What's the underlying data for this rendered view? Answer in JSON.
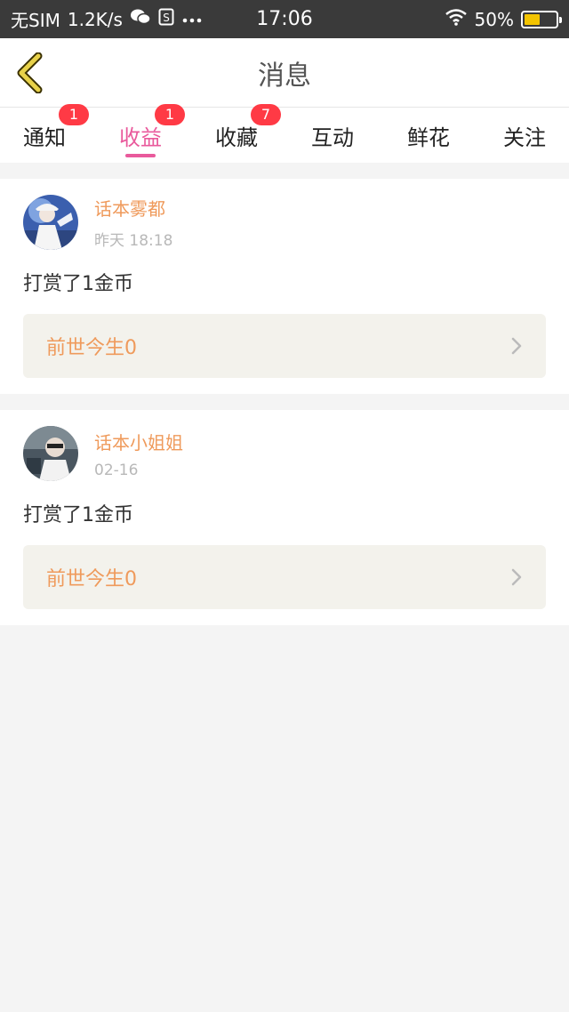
{
  "status_bar": {
    "carrier": "无SIM",
    "speed": "1.2K/s",
    "time": "17:06",
    "battery": "50%",
    "battery_level": 0.5,
    "icons": [
      "wechat-icon",
      "sim-card-icon",
      "more-dots-icon",
      "wifi-icon",
      "battery-icon"
    ]
  },
  "header": {
    "title": "消息"
  },
  "tabs": [
    {
      "label": "通知",
      "badge": "1",
      "active": false
    },
    {
      "label": "收益",
      "badge": "1",
      "active": true
    },
    {
      "label": "收藏",
      "badge": "7",
      "active": false
    },
    {
      "label": "互动",
      "badge": null,
      "active": false
    },
    {
      "label": "鲜花",
      "badge": null,
      "active": false
    },
    {
      "label": "关注",
      "badge": null,
      "active": false
    }
  ],
  "messages": [
    {
      "sender": "话本雾都",
      "time": "昨天 18:18",
      "action": "打赏了1金币",
      "book": "前世今生0"
    },
    {
      "sender": "话本小姐姐",
      "time": "02-16",
      "action": "打赏了1金币",
      "book": "前世今生0"
    }
  ],
  "colors": {
    "accent": "#e95a9c",
    "sender": "#ef9a5b",
    "badge": "#ff3a45",
    "back_icon": "#e8d24a"
  }
}
